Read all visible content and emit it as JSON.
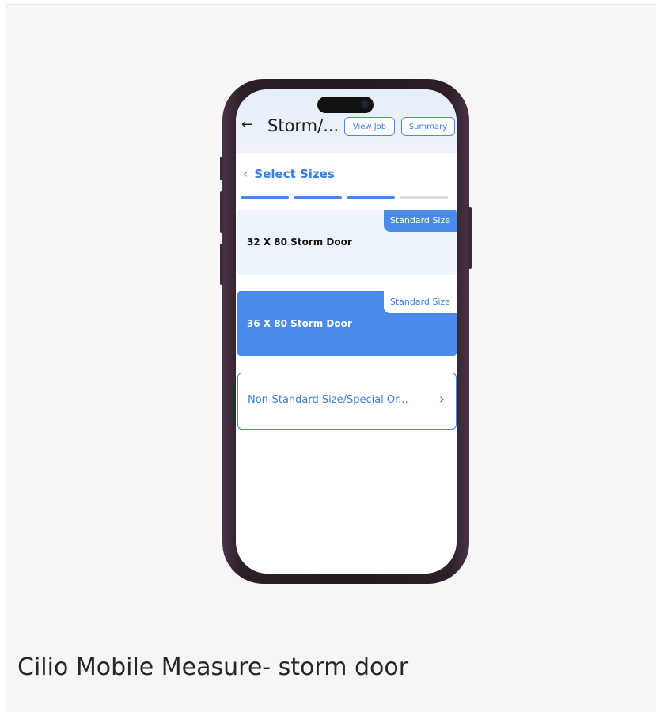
{
  "caption": "Cilio Mobile Measure- storm door",
  "header": {
    "title": "Storm/...",
    "view_job_label": "View Job",
    "summary_label": "Summary"
  },
  "section": {
    "title": "Select Sizes"
  },
  "progress": {
    "total_steps": 4,
    "completed_steps": 3,
    "active_color": "#4787e6",
    "inactive_color": "#dcdcdc"
  },
  "options": [
    {
      "label": "32 X 80 Storm Door",
      "badge": "Standard Size",
      "selected": false
    },
    {
      "label": "36 X 80 Storm Door",
      "badge": "Standard Size",
      "selected": true
    },
    {
      "label": "Non-Standard Size/Special Or...",
      "badge": "",
      "selected": false
    }
  ],
  "icons": {
    "back": "arrow-left-icon",
    "section_back": "chevron-left-icon",
    "option_next": "chevron-right-icon"
  },
  "colors": {
    "accent": "#4a8ae8",
    "phone_frame": "#2b1f29"
  }
}
